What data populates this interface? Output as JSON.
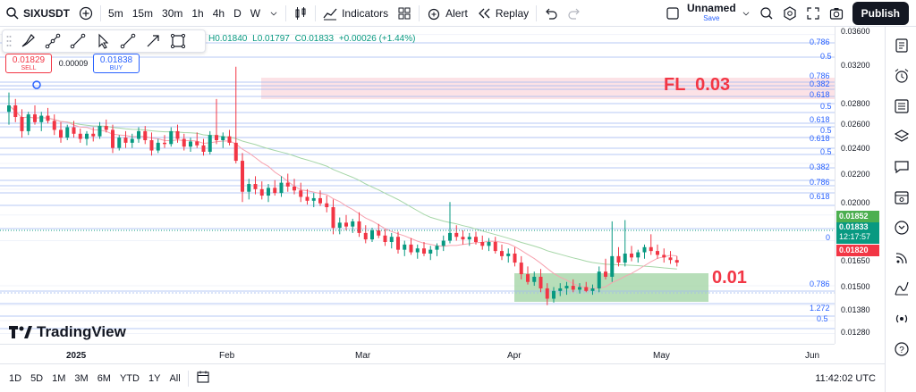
{
  "topbar": {
    "symbol": "SIXUSDT",
    "intervals": [
      "5m",
      "15m",
      "30m",
      "1h",
      "4h",
      "D",
      "W"
    ],
    "indicators_label": "Indicators",
    "alert_label": "Alert",
    "replay_label": "Replay",
    "layout_name": "Unnamed",
    "layout_status": "Save",
    "publish_label": "Publish"
  },
  "legend": {
    "high": "H0.01840",
    "low": "L0.01797",
    "close": "C0.01833",
    "change": "+0.00026 (+1.44%)"
  },
  "trade": {
    "sell_price": "0.01829",
    "sell_label": "SELL",
    "spread": "0.00009",
    "buy_price": "0.01838",
    "buy_label": "BUY"
  },
  "price_axis": {
    "labels": [
      "0.03600",
      "0.03200",
      "0.02800",
      "0.02600",
      "0.02400",
      "0.02200",
      "0.02000",
      "0.01650",
      "0.01500",
      "0.01380",
      "0.01280"
    ],
    "current_price": "0.01852",
    "last_price": "0.01833",
    "countdown": "12:17:57",
    "low_price": "0.01820"
  },
  "fib_labels": [
    "0.786",
    "0.5",
    "0.786",
    "0.382",
    "0.618",
    "0.5",
    "0.618",
    "0.5",
    "0.618",
    "0.5",
    "0.382",
    "0.786",
    "0.618",
    "0",
    "0.786",
    "1.272",
    "0.5"
  ],
  "annotations": {
    "fl_text": "FL  0.03",
    "support_text": "0.01"
  },
  "time_axis": {
    "labels": [
      "2025",
      "Feb",
      "Mar",
      "Apr",
      "May",
      "Jun"
    ]
  },
  "bottombar": {
    "ranges": [
      "1D",
      "5D",
      "1M",
      "3M",
      "6M",
      "YTD",
      "1Y",
      "All"
    ],
    "clock": "11:42:02 UTC"
  },
  "logo_text": "TradingView",
  "colors": {
    "up": "#089981",
    "down": "#f23645",
    "fib": "#2962ff",
    "ma_fast": "#f7a3b0",
    "ma_slow": "#a5d6a7"
  },
  "chart_data": {
    "type": "candlestick",
    "candles": [
      [
        0.03,
        0.0315,
        0.029,
        0.0305
      ],
      [
        0.0305,
        0.031,
        0.0292,
        0.0296
      ],
      [
        0.0296,
        0.0302,
        0.028,
        0.0285
      ],
      [
        0.0285,
        0.03,
        0.0282,
        0.0298
      ],
      [
        0.0298,
        0.0305,
        0.029,
        0.0292
      ],
      [
        0.0292,
        0.03,
        0.0285,
        0.0297
      ],
      [
        0.0297,
        0.0303,
        0.0291,
        0.0293
      ],
      [
        0.0293,
        0.0298,
        0.0282,
        0.0286
      ],
      [
        0.0286,
        0.0292,
        0.0276,
        0.028
      ],
      [
        0.028,
        0.029,
        0.0278,
        0.0288
      ],
      [
        0.0288,
        0.0293,
        0.028,
        0.0283
      ],
      [
        0.0283,
        0.0287,
        0.0276,
        0.0279
      ],
      [
        0.0279,
        0.0285,
        0.0274,
        0.0283
      ],
      [
        0.0283,
        0.0288,
        0.0277,
        0.0281
      ],
      [
        0.0281,
        0.0292,
        0.0279,
        0.0289
      ],
      [
        0.0289,
        0.0294,
        0.0284,
        0.0286
      ],
      [
        0.0286,
        0.029,
        0.0268,
        0.0272
      ],
      [
        0.0272,
        0.0282,
        0.027,
        0.028
      ],
      [
        0.028,
        0.0285,
        0.0272,
        0.0276
      ],
      [
        0.0276,
        0.0283,
        0.0272,
        0.0279
      ],
      [
        0.0279,
        0.0288,
        0.0276,
        0.0285
      ],
      [
        0.0285,
        0.0289,
        0.0275,
        0.0278
      ],
      [
        0.0278,
        0.0284,
        0.0266,
        0.027
      ],
      [
        0.027,
        0.0279,
        0.0268,
        0.0276
      ],
      [
        0.0276,
        0.0282,
        0.0272,
        0.0275
      ],
      [
        0.0275,
        0.0288,
        0.0273,
        0.0285
      ],
      [
        0.0285,
        0.029,
        0.0276,
        0.0279
      ],
      [
        0.0279,
        0.0283,
        0.027,
        0.0273
      ],
      [
        0.0273,
        0.028,
        0.0269,
        0.0277
      ],
      [
        0.0277,
        0.0284,
        0.0272,
        0.0274
      ],
      [
        0.0274,
        0.0279,
        0.0266,
        0.0269
      ],
      [
        0.0269,
        0.0285,
        0.0267,
        0.0282
      ],
      [
        0.0282,
        0.031,
        0.0275,
        0.0278
      ],
      [
        0.0278,
        0.0284,
        0.0272,
        0.0281
      ],
      [
        0.0281,
        0.0286,
        0.0274,
        0.0276
      ],
      [
        0.0276,
        0.0335,
        0.026,
        0.0262
      ],
      [
        0.0262,
        0.0268,
        0.023,
        0.0238
      ],
      [
        0.0238,
        0.0248,
        0.0232,
        0.0244
      ],
      [
        0.0244,
        0.025,
        0.0236,
        0.024
      ],
      [
        0.024,
        0.0246,
        0.0232,
        0.0235
      ],
      [
        0.0235,
        0.0244,
        0.023,
        0.0241
      ],
      [
        0.0241,
        0.0247,
        0.0235,
        0.0237
      ],
      [
        0.0237,
        0.025,
        0.0234,
        0.0245
      ],
      [
        0.0245,
        0.0252,
        0.0238,
        0.0242
      ],
      [
        0.0242,
        0.0248,
        0.0236,
        0.0239
      ],
      [
        0.0239,
        0.0245,
        0.023,
        0.0234
      ],
      [
        0.0234,
        0.024,
        0.0228,
        0.0231
      ],
      [
        0.0231,
        0.0237,
        0.0226,
        0.0233
      ],
      [
        0.0233,
        0.0239,
        0.0227,
        0.0229
      ],
      [
        0.0229,
        0.0235,
        0.0222,
        0.0226
      ],
      [
        0.0226,
        0.0232,
        0.0205,
        0.021
      ],
      [
        0.021,
        0.0218,
        0.0205,
        0.0214
      ],
      [
        0.0214,
        0.022,
        0.0208,
        0.0211
      ],
      [
        0.0211,
        0.0217,
        0.0206,
        0.0215
      ],
      [
        0.0215,
        0.0222,
        0.0203,
        0.0206
      ],
      [
        0.0206,
        0.0212,
        0.0198,
        0.0201
      ],
      [
        0.0201,
        0.021,
        0.0199,
        0.0208
      ],
      [
        0.0208,
        0.0213,
        0.0202,
        0.0204
      ],
      [
        0.0204,
        0.0209,
        0.0196,
        0.0199
      ],
      [
        0.0199,
        0.0206,
        0.0194,
        0.0203
      ],
      [
        0.0203,
        0.0207,
        0.019,
        0.0193
      ],
      [
        0.0193,
        0.02,
        0.0188,
        0.0197
      ],
      [
        0.0197,
        0.0202,
        0.0189,
        0.0191
      ],
      [
        0.0191,
        0.0197,
        0.0186,
        0.0194
      ],
      [
        0.0194,
        0.0199,
        0.0188,
        0.019
      ],
      [
        0.019,
        0.0196,
        0.0185,
        0.0193
      ],
      [
        0.0193,
        0.0198,
        0.0188,
        0.0196
      ],
      [
        0.0196,
        0.0204,
        0.0192,
        0.02
      ],
      [
        0.02,
        0.023,
        0.0198,
        0.0206
      ],
      [
        0.0206,
        0.0212,
        0.02,
        0.0203
      ],
      [
        0.0203,
        0.0208,
        0.0197,
        0.0201
      ],
      [
        0.0201,
        0.0206,
        0.0196,
        0.0203
      ],
      [
        0.0203,
        0.0207,
        0.0197,
        0.0199
      ],
      [
        0.0199,
        0.0204,
        0.0193,
        0.0196
      ],
      [
        0.0196,
        0.0202,
        0.0192,
        0.0199
      ],
      [
        0.0199,
        0.0203,
        0.019,
        0.0192
      ],
      [
        0.0192,
        0.0197,
        0.0185,
        0.0188
      ],
      [
        0.0188,
        0.0194,
        0.0183,
        0.019
      ],
      [
        0.019,
        0.0195,
        0.018,
        0.0183
      ],
      [
        0.0183,
        0.0188,
        0.017,
        0.0174
      ],
      [
        0.0174,
        0.018,
        0.0166,
        0.0168
      ],
      [
        0.0168,
        0.0176,
        0.0165,
        0.0172
      ],
      [
        0.0172,
        0.0178,
        0.016,
        0.0163
      ],
      [
        0.0163,
        0.0167,
        0.015,
        0.0155
      ],
      [
        0.0155,
        0.0164,
        0.0152,
        0.0161
      ],
      [
        0.0161,
        0.0167,
        0.0157,
        0.0163
      ],
      [
        0.0163,
        0.0168,
        0.0158,
        0.0165
      ],
      [
        0.0165,
        0.017,
        0.016,
        0.0162
      ],
      [
        0.0162,
        0.0167,
        0.0159,
        0.0164
      ],
      [
        0.0164,
        0.0168,
        0.016,
        0.0161
      ],
      [
        0.0161,
        0.0166,
        0.0158,
        0.0163
      ],
      [
        0.0163,
        0.018,
        0.016,
        0.0176
      ],
      [
        0.0176,
        0.0186,
        0.017,
        0.0172
      ],
      [
        0.0172,
        0.0215,
        0.0168,
        0.0188
      ],
      [
        0.0188,
        0.0195,
        0.018,
        0.0183
      ],
      [
        0.0183,
        0.0216,
        0.018,
        0.019
      ],
      [
        0.019,
        0.0196,
        0.0184,
        0.0187
      ],
      [
        0.0187,
        0.0193,
        0.0183,
        0.0191
      ],
      [
        0.0191,
        0.0197,
        0.0186,
        0.0195
      ],
      [
        0.0195,
        0.0205,
        0.0189,
        0.0192
      ],
      [
        0.0192,
        0.0197,
        0.0186,
        0.0189
      ],
      [
        0.0189,
        0.0194,
        0.0183,
        0.0187
      ],
      [
        0.0187,
        0.0192,
        0.0182,
        0.0185
      ],
      [
        0.0185,
        0.0188,
        0.018,
        0.0183
      ]
    ]
  }
}
